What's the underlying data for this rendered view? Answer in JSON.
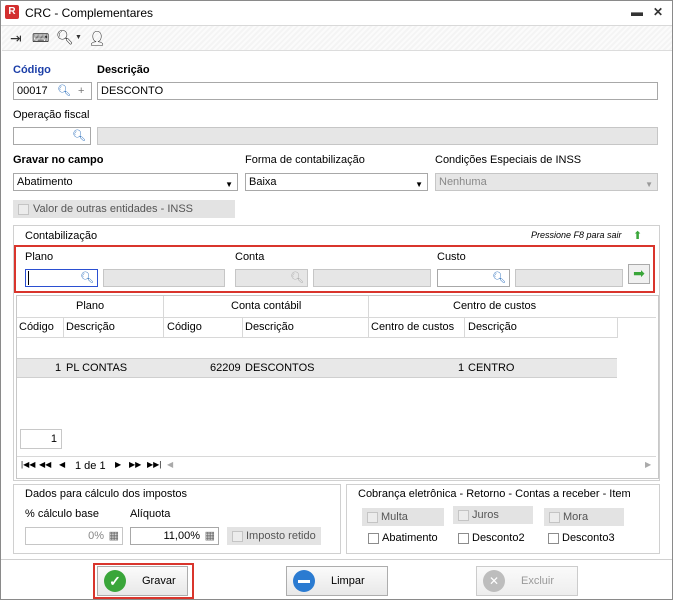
{
  "window": {
    "title": "CRC - Complementares",
    "app_icon": "app-logo-icon"
  },
  "toolbar": {
    "icons": [
      "exit-icon",
      "keyboard-icon",
      "search-icon",
      "user-icon"
    ]
  },
  "form": {
    "codigo_label": "Código",
    "descricao_label": "Descrição",
    "codigo_value": "00017",
    "descricao_value": "DESCONTO",
    "operacao_fiscal_label": "Operação fiscal",
    "operacao_fiscal_value": "",
    "gravar_no_campo_label": "Gravar no campo",
    "gravar_no_campo_value": "Abatimento",
    "forma_label": "Forma de contabilização",
    "forma_value": "Baixa",
    "condicoes_label": "Condições Especiais de INSS",
    "condicoes_value": "Nenhuma",
    "valor_outras_label": "Valor de outras entidades - INSS"
  },
  "contabilizacao": {
    "title": "Contabilização",
    "hint": "Pressione F8 para sair",
    "plano_label": "Plano",
    "conta_label": "Conta",
    "custo_label": "Custo"
  },
  "grid": {
    "group_headers": [
      "Plano",
      "Conta contábil",
      "Centro de custos"
    ],
    "columns": [
      "Código",
      "Descrição",
      "Código",
      "Descrição",
      "Centro de custos",
      "Descrição"
    ],
    "rows": [
      {
        "codigo": "1",
        "plano": "PL CONTAS",
        "conta_codigo": "62209",
        "conta_descricao": "DESCONTOS",
        "centro": "1",
        "centro_descricao": "CENTRO"
      }
    ],
    "count": "1",
    "pager": "1 de 1"
  },
  "impostos": {
    "title": "Dados para cálculo dos impostos",
    "calc_base_label": "% cálculo base",
    "calc_base_value": "0%",
    "aliquota_label": "Alíquota",
    "aliquota_value": "11,00%",
    "imposto_retido_label": "Imposto retido"
  },
  "cobranca": {
    "title": "Cobrança eletrônica - Retorno - Contas a receber - Item",
    "multa": "Multa",
    "juros": "Juros",
    "mora": "Mora",
    "abatimento": "Abatimento",
    "desconto2": "Desconto2",
    "desconto3": "Desconto3"
  },
  "buttons": {
    "gravar": "Gravar",
    "limpar": "Limpar",
    "excluir": "Excluir"
  },
  "colors": {
    "accent_blue": "#1c3fa8",
    "highlight_red": "#d9352c",
    "green": "#3aa63a"
  }
}
